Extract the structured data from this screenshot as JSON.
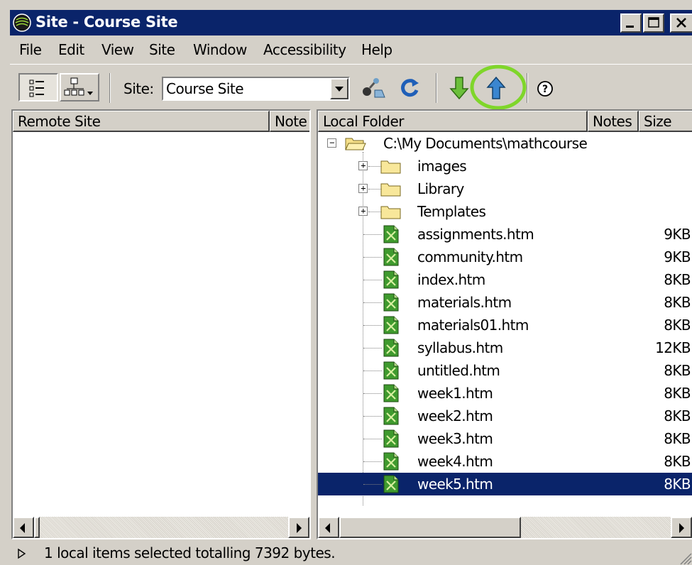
{
  "window": {
    "title": "Site - Course Site",
    "controls": [
      "minimize-icon",
      "maximize-icon",
      "close-icon"
    ]
  },
  "menubar": {
    "items": [
      "File",
      "Edit",
      "View",
      "Site",
      "Window",
      "Accessibility",
      "Help"
    ]
  },
  "toolbar": {
    "site_label": "Site:",
    "site_value": "Course Site",
    "buttons": [
      "site-files-view-icon",
      "site-map-view-icon",
      "connect-icon",
      "refresh-icon",
      "get-files-icon",
      "put-files-icon",
      "help-icon"
    ]
  },
  "remote_panel": {
    "headers": [
      "Remote Site",
      "Note"
    ]
  },
  "local_panel": {
    "headers": [
      "Local Folder",
      "Notes",
      "Size"
    ],
    "root": "C:\\My Documents\\mathcourse",
    "folders": [
      "images",
      "Library",
      "Templates"
    ],
    "files": [
      {
        "name": "assignments.htm",
        "size": "9KB"
      },
      {
        "name": "community.htm",
        "size": "9KB"
      },
      {
        "name": "index.htm",
        "size": "8KB"
      },
      {
        "name": "materials.htm",
        "size": "8KB"
      },
      {
        "name": "materials01.htm",
        "size": "8KB"
      },
      {
        "name": "syllabus.htm",
        "size": "12KB"
      },
      {
        "name": "untitled.htm",
        "size": "8KB"
      },
      {
        "name": "week1.htm",
        "size": "8KB"
      },
      {
        "name": "week2.htm",
        "size": "8KB"
      },
      {
        "name": "week3.htm",
        "size": "8KB"
      },
      {
        "name": "week4.htm",
        "size": "8KB"
      },
      {
        "name": "week5.htm",
        "size": "8KB",
        "selected": true
      }
    ]
  },
  "status": {
    "text": "1 local items selected totalling 7392 bytes."
  },
  "colors": {
    "titlebar": "#0a246a",
    "selection": "#0a246a",
    "highlight_ring": "#7fd62a",
    "face": "#d4d0c8"
  }
}
